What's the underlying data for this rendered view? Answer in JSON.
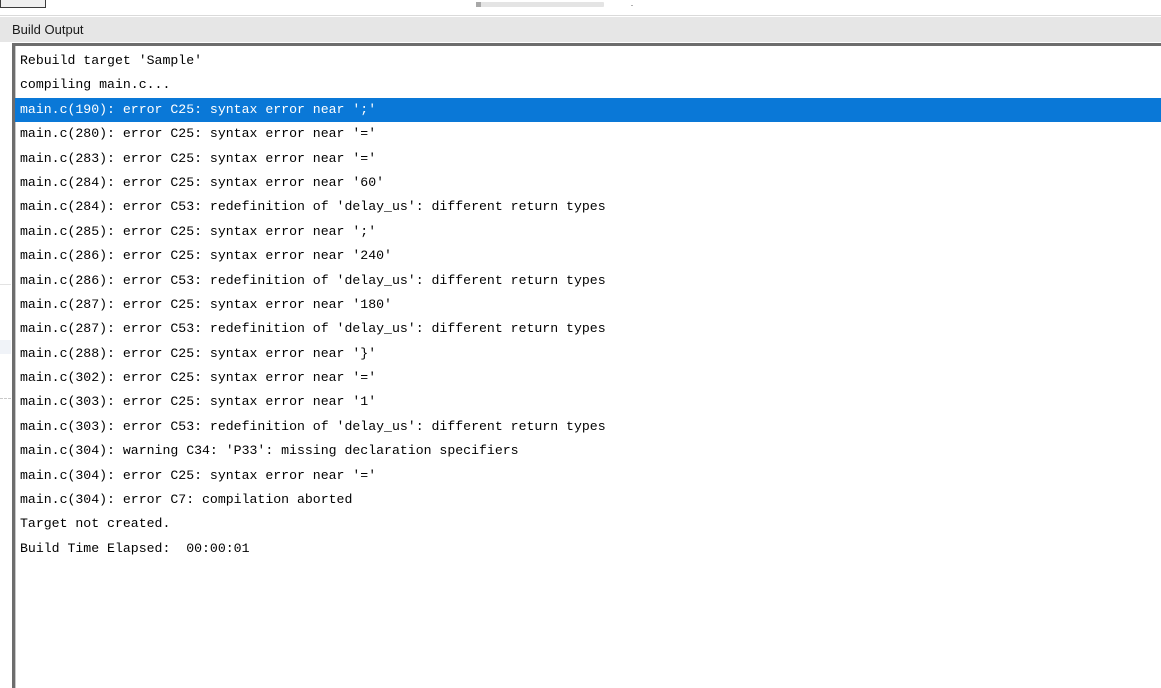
{
  "window": {
    "title": "Build Output"
  },
  "colors": {
    "selection": "#0a78d7",
    "title_bar": "#e6e6e6",
    "panel_border": "#6d6d6d"
  },
  "output_lines": [
    "Rebuild target 'Sample'",
    "compiling main.c...",
    "main.c(190): error C25: syntax error near ';'",
    "main.c(280): error C25: syntax error near '='",
    "main.c(283): error C25: syntax error near '='",
    "main.c(284): error C25: syntax error near '60'",
    "main.c(284): error C53: redefinition of 'delay_us': different return types",
    "main.c(285): error C25: syntax error near ';'",
    "main.c(286): error C25: syntax error near '240'",
    "main.c(286): error C53: redefinition of 'delay_us': different return types",
    "main.c(287): error C25: syntax error near '180'",
    "main.c(287): error C53: redefinition of 'delay_us': different return types",
    "main.c(288): error C25: syntax error near '}'",
    "main.c(302): error C25: syntax error near '='",
    "main.c(303): error C25: syntax error near '1'",
    "main.c(303): error C53: redefinition of 'delay_us': different return types",
    "main.c(304): warning C34: 'P33': missing declaration specifiers",
    "main.c(304): error C25: syntax error near '='",
    "main.c(304): error C7: compilation aborted",
    "Target not created.",
    "Build Time Elapsed:  00:00:01"
  ],
  "selected_line_index": 2
}
